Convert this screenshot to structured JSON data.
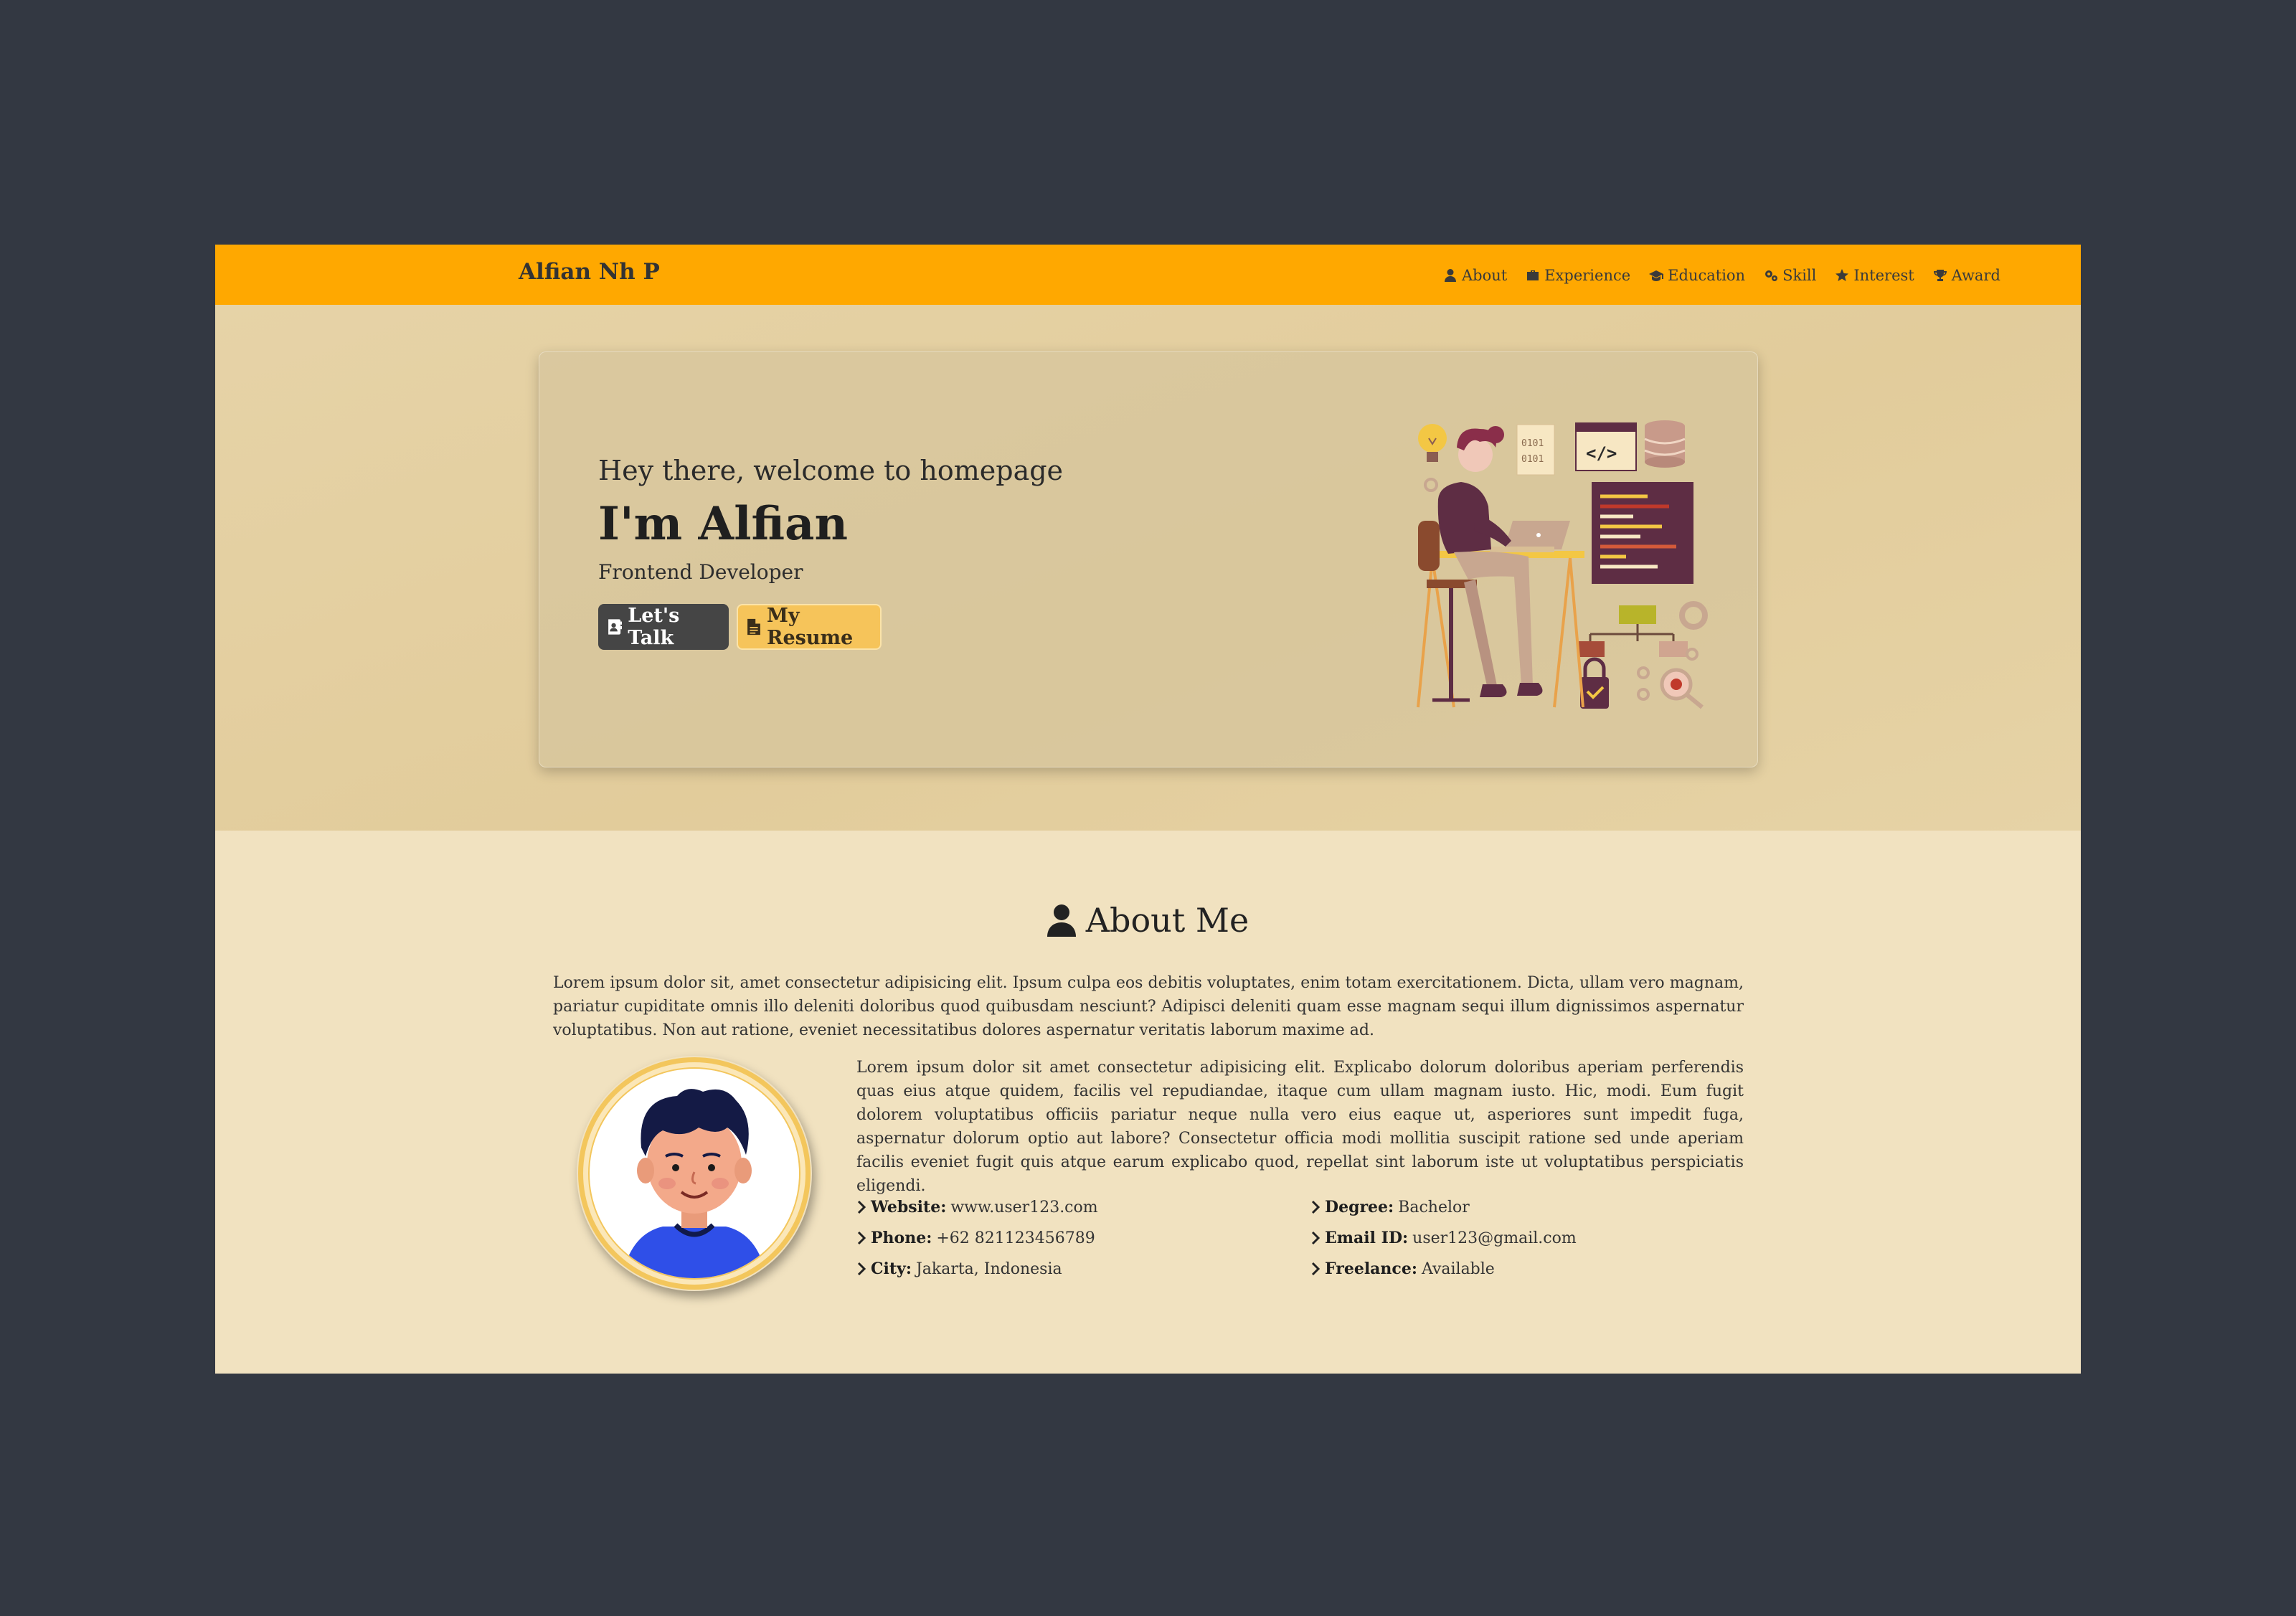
{
  "brand": "Alfian Nh P",
  "nav": [
    {
      "icon": "user-icon",
      "label": "About"
    },
    {
      "icon": "briefcase-icon",
      "label": "Experience"
    },
    {
      "icon": "graduation-cap-icon",
      "label": "Education"
    },
    {
      "icon": "gears-icon",
      "label": "Skill"
    },
    {
      "icon": "star-icon",
      "label": "Interest"
    },
    {
      "icon": "trophy-icon",
      "label": "Award"
    }
  ],
  "hero": {
    "greeting": "Hey there, welcome to homepage",
    "name": "I'm Alfian",
    "role": "Frontend Developer",
    "talk_button": "Let's Talk",
    "resume_button": "My Resume",
    "illustration_icon": "developer-at-desk-illustration",
    "illustration_code_label": "</>",
    "illustration_binary_top": "0101",
    "illustration_binary_bottom": "0101"
  },
  "about": {
    "title": "About Me",
    "intro": "Lorem ipsum dolor sit, amet consectetur adipisicing elit. Ipsum culpa eos debitis voluptates, enim totam exercitationem. Dicta, ullam vero magnam, pariatur cupiditate omnis illo deleniti doloribus quod quibusdam nesciunt? Adipisci deleniti quam esse magnam sequi illum dignissimos aspernatur voluptatibus. Non aut ratione, eveniet necessitatibus dolores aspernatur veritatis laborum maxime ad.",
    "bio": "Lorem ipsum dolor sit amet consectetur adipisicing elit. Explicabo dolorum doloribus aperiam perferendis quas eius atque quidem, facilis vel repudiandae, itaque cum ullam magnam iusto. Hic, modi. Eum fugit dolorem voluptatibus officiis pariatur neque nulla vero eius eaque ut, asperiores sunt impedit fuga, aspernatur dolorum optio aut labore? Consectetur officia modi mollitia suscipit ratione sed unde aperiam facilis eveniet fugit quis atque earum explicabo quod, repellat sint laborum iste ut voluptatibus perspiciatis eligendi.",
    "avatar_icon": "avatar-illustration",
    "details": [
      {
        "label": "Website:",
        "value": "www.user123.com"
      },
      {
        "label": "Phone:",
        "value": "+62 821123456789"
      },
      {
        "label": "City:",
        "value": "Jakarta, Indonesia"
      },
      {
        "label": "Degree:",
        "value": "Bachelor"
      },
      {
        "label": "Email ID:",
        "value": "user123@gmail.com"
      },
      {
        "label": "Freelance:",
        "value": "Available"
      }
    ]
  },
  "colors": {
    "navbar": "#ffa800",
    "page_bg": "#f1e2c0",
    "outer_bg": "#333842",
    "button_dark": "#454545",
    "button_accent": "#f6c45a"
  }
}
